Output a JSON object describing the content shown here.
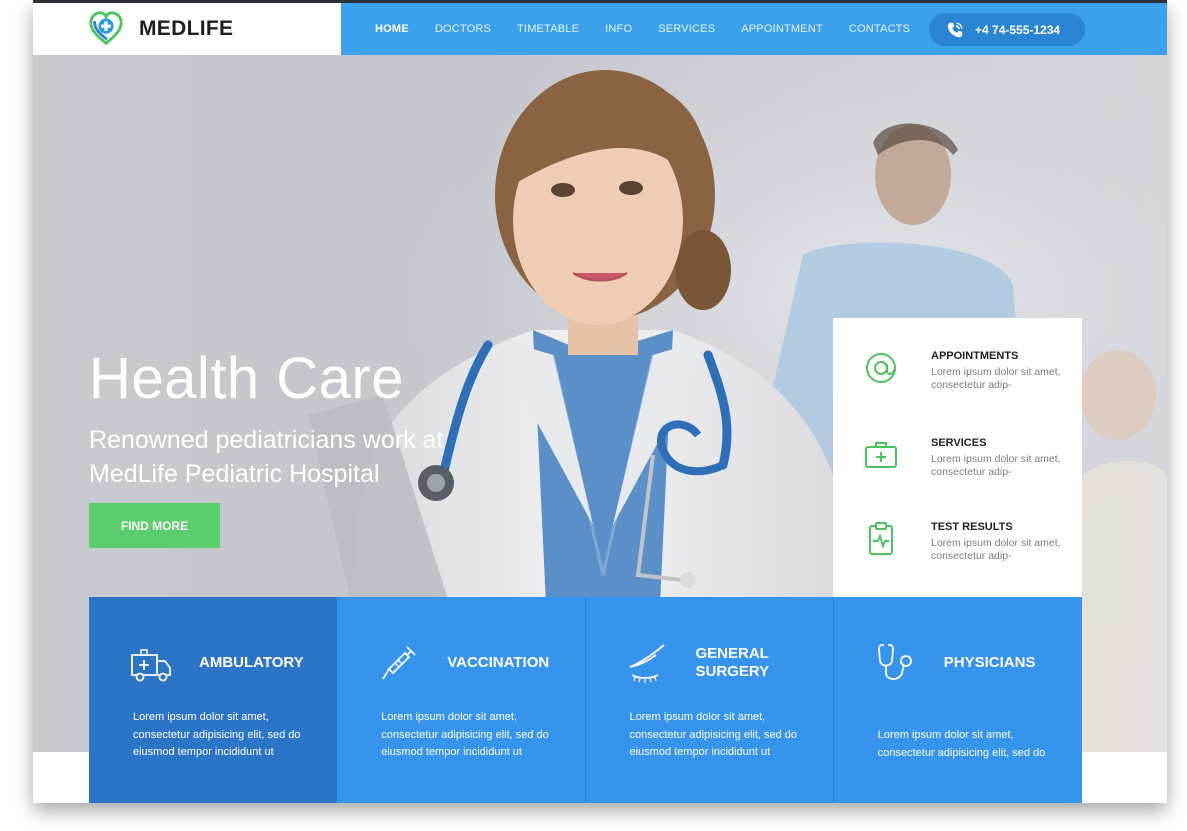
{
  "header": {
    "logo_text": "MEDLIFE",
    "nav": [
      "HOME",
      "DOCTORS",
      "TIMETABLE",
      "INFO",
      "SERVICES",
      "APPOINTMENT",
      "CONTACTS"
    ],
    "active_nav": "HOME",
    "phone": "+4 74-555-1234"
  },
  "hero": {
    "title": "Health Care",
    "subtitle": "Renowned pediatricians work at MedLife Pediatric Hospital",
    "cta": "FIND MORE"
  },
  "info_card": [
    {
      "title": "APPOINTMENTS",
      "desc": "Lorem ipsum dolor sit amet, consectetur adip-",
      "icon": "at-sign-icon"
    },
    {
      "title": "SERVICES",
      "desc": "Lorem ipsum dolor sit amet, consectetur adip-",
      "icon": "medical-kit-icon"
    },
    {
      "title": "TEST RESULTS",
      "desc": "Lorem ipsum dolor sit amet, consectetur adip-",
      "icon": "clipboard-pulse-icon"
    }
  ],
  "features": [
    {
      "title": "AMBULATORY",
      "desc": "Lorem ipsum dolor sit amet, consectetur adipisicing elit, sed do eiusmod tempor incididunt ut",
      "icon": "ambulance-icon"
    },
    {
      "title": "VACCINATION",
      "desc": "Lorem ipsum dolor sit amet, consectetur adipisicing elit, sed do eiusmod tempor incididunt ut",
      "icon": "syringe-icon"
    },
    {
      "title": "GENERAL SURGERY",
      "desc": "Lorem ipsum dolor sit amet, consectetur adipisicing elit, sed do eiusmod tempor incididunt ut",
      "icon": "scalpel-icon"
    },
    {
      "title": "PHYSICIANS",
      "desc": "Lorem ipsum dolor sit amet, consectetur adipisicing elit, sed do",
      "icon": "stethoscope-icon"
    }
  ],
  "colors": {
    "nav_blue": "#3ba1ec",
    "phone_pill": "#2a86d3",
    "cta_green": "#5ccd6c",
    "icon_green": "#4cc35e",
    "feature_blue": "#3794ec",
    "feature_dark": "#2c74c6"
  }
}
